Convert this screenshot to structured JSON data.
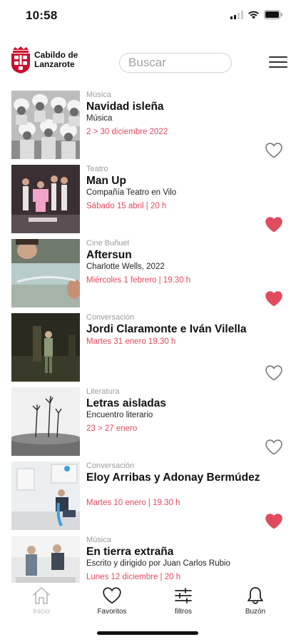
{
  "status_bar": {
    "time": "10:58"
  },
  "header": {
    "logo_line1": "Cabildo de",
    "logo_line2": "Lanzarote",
    "search_placeholder": "Buscar"
  },
  "colors": {
    "accent": "#e24a5e",
    "muted": "#9b9b9b",
    "tab_inactive": "#bdbdbd"
  },
  "events": [
    {
      "category": "Música",
      "title": "Navidad isleña",
      "subtitle": "Música",
      "date": "2 > 30 diciembre 2022",
      "favorite": false
    },
    {
      "category": "Teatro",
      "title": "Man Up",
      "subtitle": "Compañía Teatro en Vilo",
      "date": "Sábado 15 abril | 20 h",
      "favorite": true
    },
    {
      "category": "Cine Buñuel",
      "title": "Aftersun",
      "subtitle": "Charlotte Wells, 2022",
      "date": "Miércoles 1 febrero | 19.30 h",
      "favorite": true
    },
    {
      "category": "Conversación",
      "title": "Jordi Claramonte e Iván Vilella",
      "subtitle": "",
      "date": "Martes 31 enero 19.30 h",
      "favorite": false
    },
    {
      "category": "Literatura",
      "title": "Letras aisladas",
      "subtitle": "Encuentro literario",
      "date": "23 > 27 enero",
      "favorite": false
    },
    {
      "category": "Conversación",
      "title": "Eloy Arribas y Adonay Bermúdez",
      "subtitle": "",
      "date": "Martes 10 enero | 19.30 h",
      "favorite": true
    },
    {
      "category": "Música",
      "title": "En tierra extraña",
      "subtitle": "Escrito y dirigido por Juan Carlos Rubio",
      "date": "Lunes 12 diciembre | 20 h",
      "favorite": false
    }
  ],
  "tabs": [
    {
      "label": "Inicio",
      "icon": "home-icon",
      "active": false
    },
    {
      "label": "Favoritos",
      "icon": "heart-icon",
      "active": true
    },
    {
      "label": "filtros",
      "icon": "sliders-icon",
      "active": true
    },
    {
      "label": "Buzón",
      "icon": "bell-icon",
      "active": true
    }
  ]
}
